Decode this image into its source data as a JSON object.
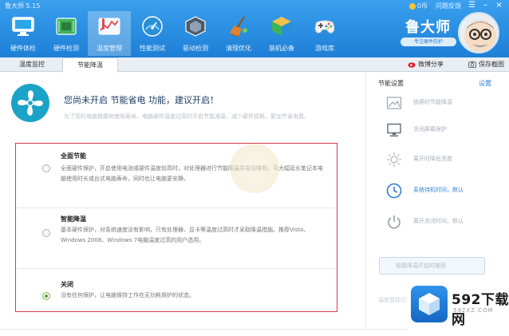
{
  "window": {
    "app_title": "鲁大师 5.15",
    "links": [
      "0币",
      "问题反馈"
    ],
    "controls": [
      "☰",
      "–",
      "×"
    ]
  },
  "nav": {
    "items": [
      {
        "label": "硬件体检",
        "icon": "monitor-icon"
      },
      {
        "label": "硬件检测",
        "icon": "circuit-board-icon"
      },
      {
        "label": "温度管理",
        "icon": "temperature-chart-icon",
        "active": true
      },
      {
        "label": "性能测试",
        "icon": "speedometer-icon"
      },
      {
        "label": "驱动检测",
        "icon": "driver-chip-icon"
      },
      {
        "label": "清理优化",
        "icon": "broom-icon"
      },
      {
        "label": "装机必备",
        "icon": "package-cube-icon"
      },
      {
        "label": "游戏库",
        "icon": "gamepad-icon"
      }
    ]
  },
  "brand": {
    "name": "鲁大师",
    "subtitle": "专注硬件防护"
  },
  "tabs": {
    "items": [
      "温度监控",
      "节能降温"
    ],
    "active_index": 1,
    "share_label": "微博分享",
    "save_label": "保存截图"
  },
  "hero": {
    "title": "您尚未开启 节能省电 功能，建议开启！",
    "subtitle": "为了您的电脑健康和使用寿命，电脑硬件温度过高时开启节能减温，减少硬件损耗，更加节省电费。"
  },
  "options": [
    {
      "name": "全面节能",
      "desc": "全面硬件保护，开启使用电池或硬件温度较高时，对处理器进行节能降温并自动降频，可大幅延长笔记本电脑使用时长或台式电脑寿命，同时也让电脑更安静。",
      "selected": false
    },
    {
      "name": "智能降温",
      "desc": "基本硬件保护，对系统速度没有影响，只有处理器、显卡等温度过高时才采取降温措施。推荐Vista、Windows 2008、Windows 7电脑温度过高的用户选用。",
      "selected": false
    },
    {
      "name": "关闭",
      "desc": "没有任何保护，让电脑保持工作在无功耗保护的状态。",
      "selected": true
    }
  ],
  "side": {
    "title": "节能设置",
    "more": "设置",
    "items": [
      {
        "label": "锁屏时节能降温",
        "icon": "image-frame-icon",
        "on": false
      },
      {
        "label": "关闭屏幕保护",
        "icon": "display-icon",
        "on": false
      },
      {
        "label": "离开时降低亮度",
        "icon": "brightness-icon",
        "on": false
      },
      {
        "label": "系统待机时间，默认",
        "icon": "clock-icon",
        "on": true
      },
      {
        "label": "离开关闭时间，默认",
        "icon": "power-icon",
        "on": false
      }
    ],
    "button_label": "智能降温开启时推荐",
    "footer": "温度监控已开启"
  },
  "logo": {
    "name": "592下载网",
    "url": "592XZ.COM"
  },
  "colors": {
    "accent": "#1d7fd6",
    "highlight_border": "#d43a4c",
    "selected_radio": "#5aa531",
    "link": "#2f7ed8"
  }
}
